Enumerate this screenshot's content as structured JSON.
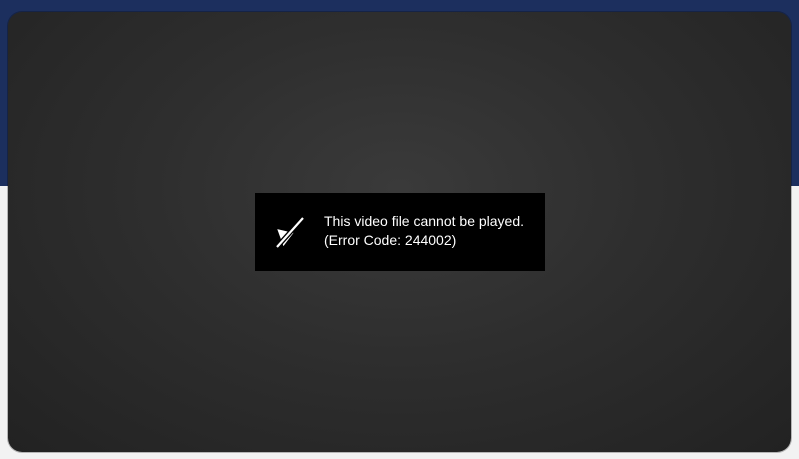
{
  "player": {
    "error": {
      "icon": "video-unavailable-icon",
      "message": "This video file cannot be played.",
      "code": "(Error Code: 244002)"
    }
  },
  "colors": {
    "page_header": "#1c2f5e",
    "page_body": "#f2f2f2",
    "player_background": "#2e2e2e",
    "error_box": "#000000",
    "error_text": "#ffffff"
  }
}
